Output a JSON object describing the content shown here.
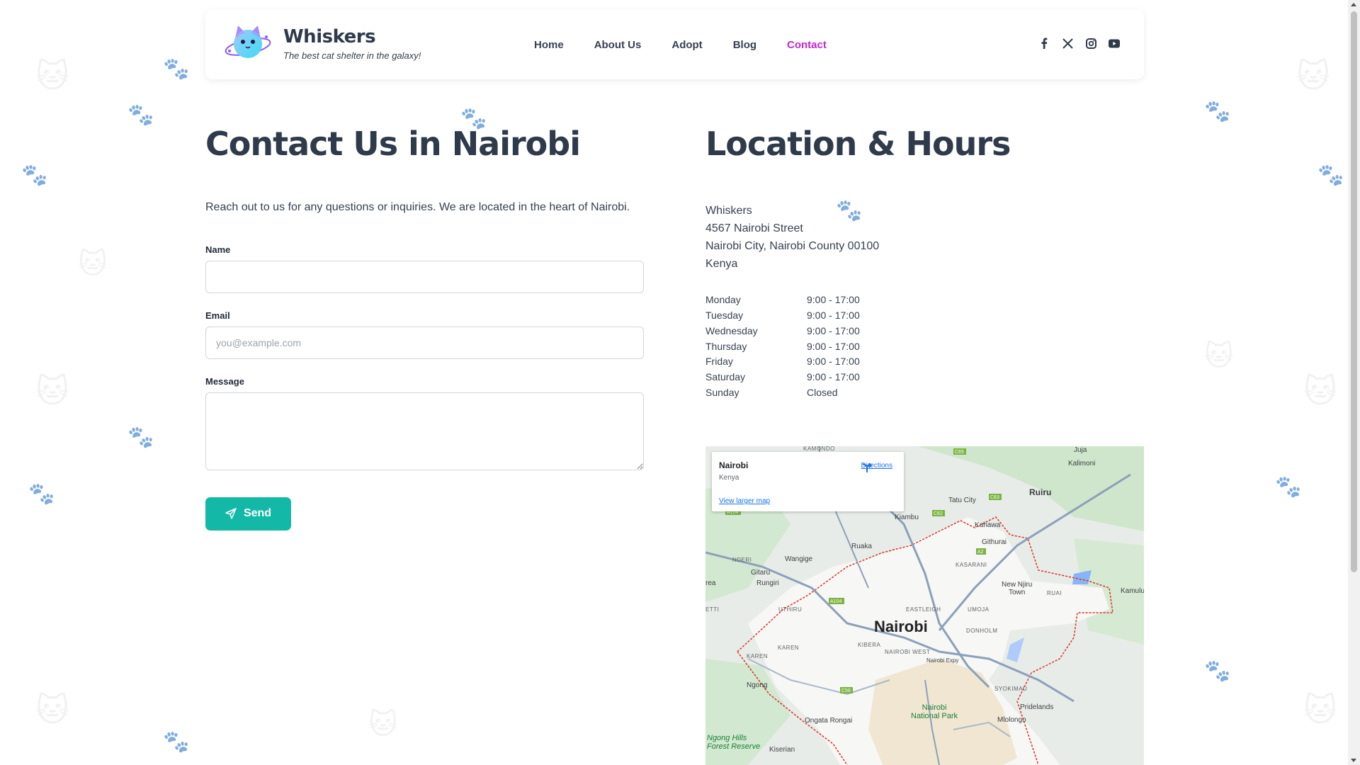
{
  "brand": {
    "name": "Whiskers",
    "tagline": "The best cat shelter in the galaxy!"
  },
  "nav": {
    "items": [
      {
        "label": "Home",
        "active": false
      },
      {
        "label": "About Us",
        "active": false
      },
      {
        "label": "Adopt",
        "active": false
      },
      {
        "label": "Blog",
        "active": false
      },
      {
        "label": "Contact",
        "active": true
      }
    ]
  },
  "social": {
    "icons": [
      "facebook-icon",
      "x-twitter-icon",
      "instagram-icon",
      "youtube-icon"
    ]
  },
  "contact": {
    "title": "Contact Us in Nairobi",
    "intro": "Reach out to us for any questions or inquiries. We are located in the heart of Nairobi.",
    "name_label": "Name",
    "name_value": "",
    "email_label": "Email",
    "email_placeholder": "you@example.com",
    "message_label": "Message",
    "message_value": "",
    "send_label": "Send"
  },
  "location": {
    "title": "Location & Hours",
    "address": [
      "Whiskers",
      "4567 Nairobi Street",
      "Nairobi City, Nairobi County 00100",
      "Kenya"
    ],
    "hours": [
      {
        "day": "Monday",
        "time": "9:00 - 17:00"
      },
      {
        "day": "Tuesday",
        "time": "9:00 - 17:00"
      },
      {
        "day": "Wednesday",
        "time": "9:00 - 17:00"
      },
      {
        "day": "Thursday",
        "time": "9:00 - 17:00"
      },
      {
        "day": "Friday",
        "time": "9:00 - 17:00"
      },
      {
        "day": "Saturday",
        "time": "9:00 - 17:00"
      },
      {
        "day": "Sunday",
        "time": "Closed"
      }
    ]
  },
  "map": {
    "card_place": "Nairobi",
    "card_country": "Kenya",
    "card_directions": "Directions",
    "card_larger": "View larger map",
    "city": "Nairobi",
    "labels": {
      "ruiru": "Ruiru",
      "juja": "Juja",
      "kalimoni": "Kalimoni",
      "kamondo": "KAMONDO",
      "tatu_city": "Tatu City",
      "kiambu": "Kiambu",
      "kahawa": "Kahawa",
      "githurai": "Githurai",
      "ruaka": "Ruaka",
      "kasarani": "KASARANI",
      "ndieri": "NDERI",
      "wangige": "Wangige",
      "gitaru": "Gitaru",
      "rungiri": "Rungiri",
      "uthiru": "UTHIRU",
      "eastleigh": "EASTLEIGH",
      "umoja": "UMOJA",
      "new_njiru": "New Njiru\nTown",
      "ruai": "RUAI",
      "kamulu": "Kamulu",
      "donholm": "DONHOLM",
      "kibera": "KIBERA",
      "nairobi_west": "NAIROBI WEST",
      "karen_small": "KAREN",
      "karen": "KAREN",
      "ngong": "Ngong",
      "embakasi_expy": "Nairobi Expy",
      "syokimau": "SYOKIMAU",
      "pridelands": "Pridelands",
      "mlolongo": "Mlolongo",
      "national_park": "Nairobi\nNational Park",
      "ongata_rongai": "Ongata Rongai",
      "ngong_hills": "Ngong Hills\nForest Reserve",
      "kiserian": "Kiserian",
      "area": "rea",
      "etti": "ETTI"
    },
    "road_shields": [
      "C65",
      "C63",
      "C62",
      "A2",
      "A104",
      "A104",
      "C58"
    ]
  },
  "colors": {
    "accent": "#c026d3",
    "button": "#14b8a6",
    "heading": "#2f3a4a"
  }
}
